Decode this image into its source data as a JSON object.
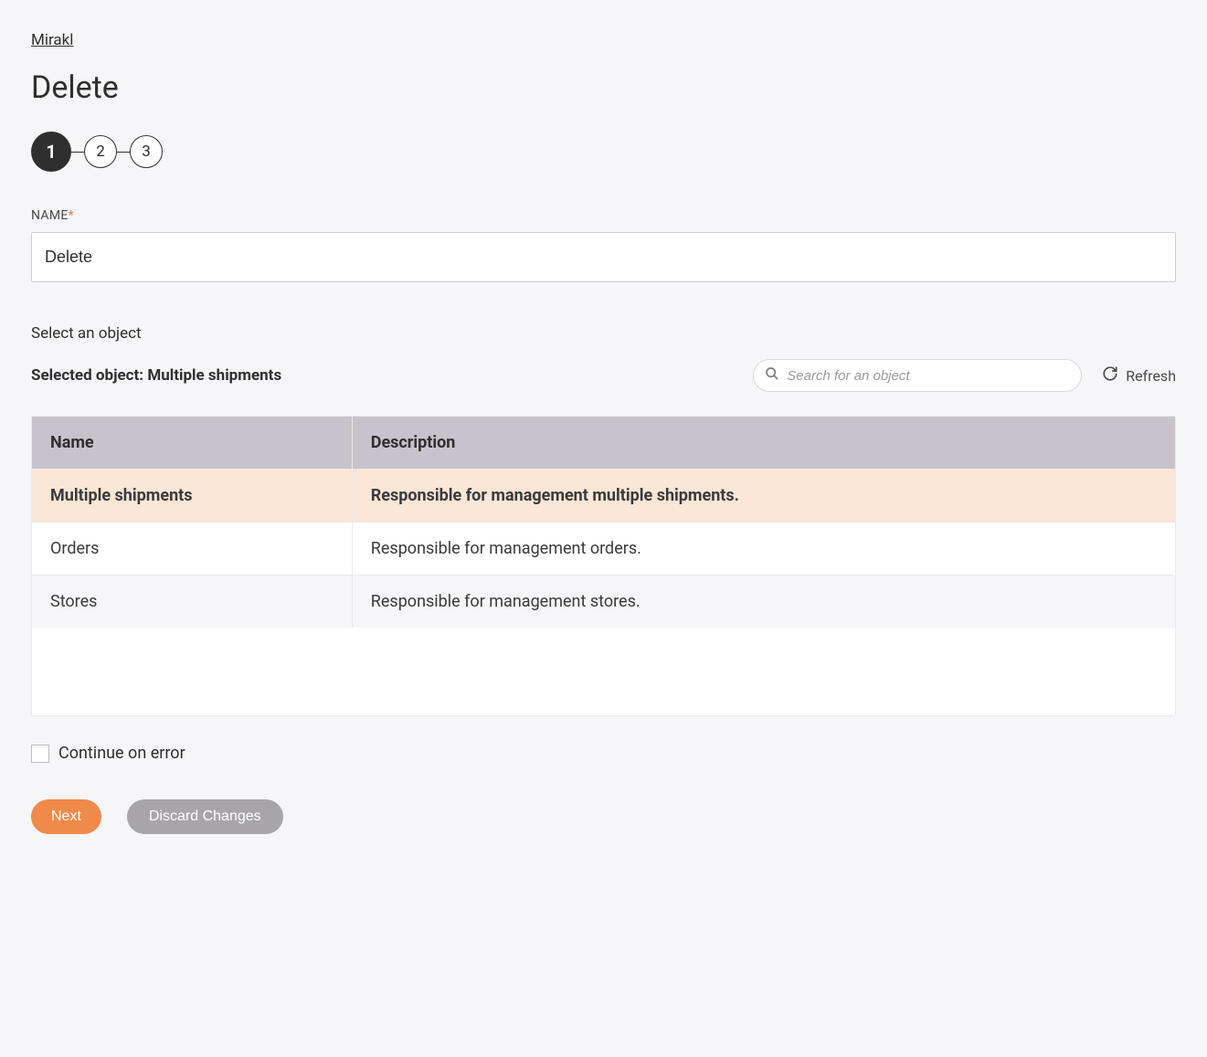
{
  "breadcrumb": {
    "label": "Mirakl"
  },
  "page_title": "Delete",
  "stepper": {
    "steps": [
      "1",
      "2",
      "3"
    ],
    "active_index": 0
  },
  "name_field": {
    "label": "NAME",
    "value": "Delete"
  },
  "object_section": {
    "prompt": "Select an object",
    "selected_prefix": "Selected object: ",
    "selected_name": "Multiple shipments",
    "search_placeholder": "Search for an object",
    "refresh_label": "Refresh"
  },
  "table": {
    "columns": {
      "name": "Name",
      "description": "Description"
    },
    "rows": [
      {
        "name": "Multiple shipments",
        "description": "Responsible for management multiple shipments.",
        "selected": true
      },
      {
        "name": "Orders",
        "description": "Responsible for management orders.",
        "selected": false
      },
      {
        "name": "Stores",
        "description": "Responsible for management stores.",
        "selected": false
      }
    ]
  },
  "continue_on_error": {
    "label": "Continue on error",
    "checked": false
  },
  "actions": {
    "next": "Next",
    "discard": "Discard Changes"
  }
}
